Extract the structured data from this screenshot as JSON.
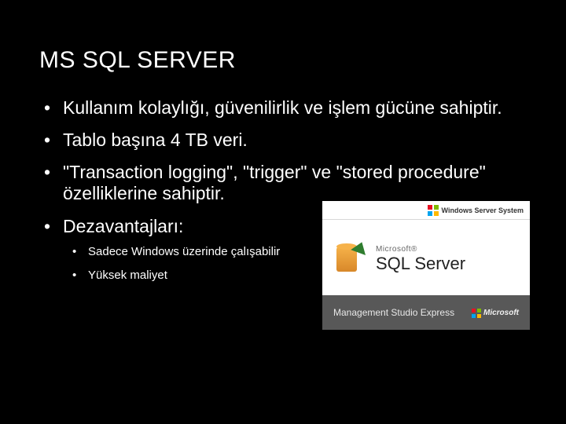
{
  "title": "MS SQL SERVER",
  "bullets": {
    "b1": "Kullanım kolaylığı, güvenilirlik ve işlem gücüne sahiptir.",
    "b2": "Tablo başına 4 TB veri.",
    "b3": "\"Transaction logging\", \"trigger\" ve \"stored procedure\" özelliklerine sahiptir.",
    "b4": "Dezavantajları:",
    "sub1": "Sadece Windows üzerinde çalışabilir",
    "sub2": "Yüksek maliyet"
  },
  "product": {
    "top_label": "Windows Server System",
    "brand_small": "Microsoft®",
    "brand_big": "SQL Server",
    "subtitle": "Management Studio Express",
    "footer_brand": "Microsoft"
  }
}
